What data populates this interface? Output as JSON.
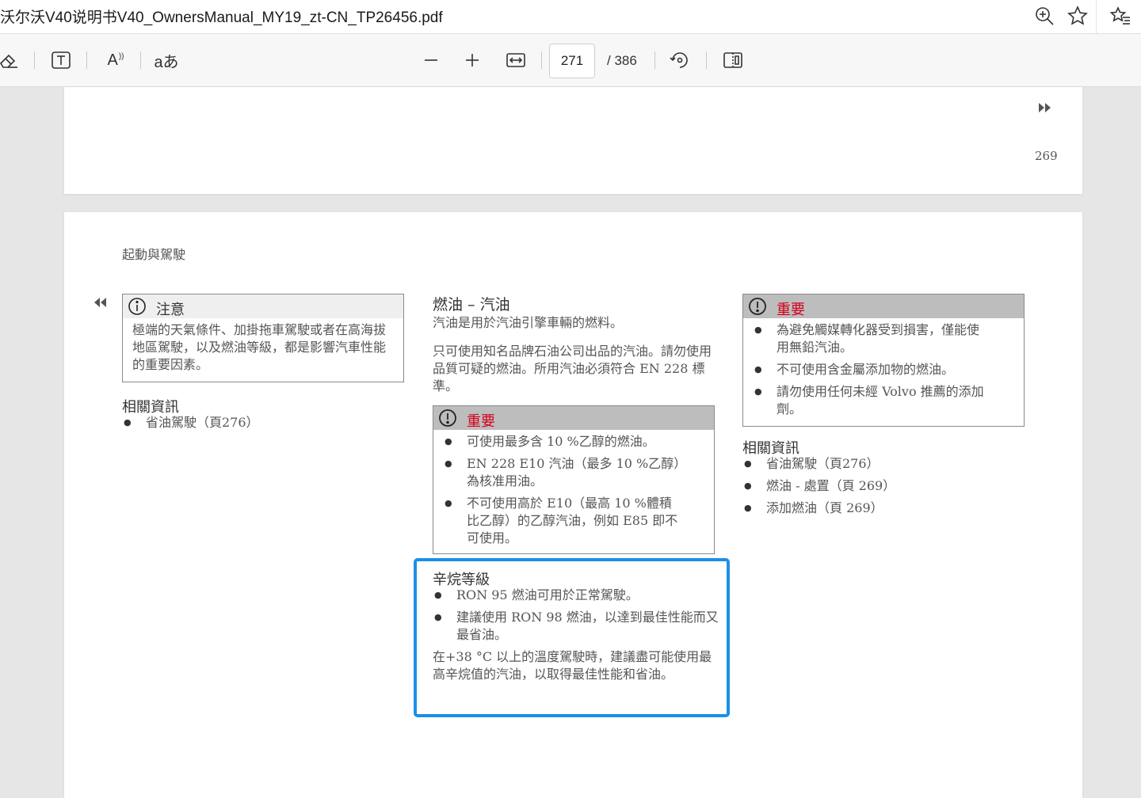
{
  "window": {
    "title": "沃尔沃V40说明书V40_OwnersManual_MY19_zt-CN_TP26456.pdf"
  },
  "titlebar": {
    "zoom_icon": "zoom-in-icon",
    "favorite_icon": "star-icon",
    "favorites_list_icon": "favorites-list-icon"
  },
  "toolbar": {
    "erase_icon": "eraser-icon",
    "text_icon": "text-box-icon",
    "read_aloud_label": "A",
    "translate_label": "aあ",
    "zoom_out_icon": "minus-icon",
    "zoom_in_icon": "plus-icon",
    "fit_icon": "fit-width-icon",
    "page_current": "271",
    "page_total": "/ 386",
    "rotate_icon": "rotate-icon",
    "layout_icon": "page-view-icon"
  },
  "page_top": {
    "page_number": "269",
    "next_icon": "double-chevron-right-icon"
  },
  "page_main": {
    "section_header": "起動與駕駛",
    "prev_icon": "double-chevron-left-icon",
    "col1": {
      "note_title": "注意",
      "note_body": "極端的天氣條件、加掛拖車駕駛或者在高海拔地區駕駛，以及燃油等級，都是影響汽車性能的重要因素。",
      "related_title": "相關資訊",
      "related_items": [
        "省油駕駛（頁276）"
      ]
    },
    "col2": {
      "title": "燃油 – 汽油",
      "subtitle": "汽油是用於汽油引擎車輛的燃料。",
      "paragraph": "只可使用知名品牌石油公司出品的汽油。請勿使用品質可疑的燃油。所用汽油必須符合 EN 228 標準。",
      "important_title": "重要",
      "important_items": [
        "可使用最多含 10 %乙醇的燃油。",
        "EN 228 E10 汽油（最多 10 %乙醇）為核准用油。",
        "不可使用高於 E10（最高 10 %體積比乙醇）的乙醇汽油，例如 E85 即不可使用。"
      ],
      "octane_title": "辛烷等級",
      "octane_items": [
        "RON 95 燃油可用於正常駕駛。",
        "建議使用 RON 98 燃油，以達到最佳性能而又最省油。"
      ],
      "octane_paragraph": "在+38 °C 以上的溫度駕駛時，建議盡可能使用最高辛烷值的汽油，以取得最佳性能和省油。"
    },
    "col3": {
      "important_title": "重要",
      "important_items": [
        "為避免觸媒轉化器受到損害，僅能使用無鉛汽油。",
        "不可使用含金屬添加物的燃油。",
        "請勿使用任何未經 Volvo 推薦的添加劑。"
      ],
      "related_title": "相關資訊",
      "related_items": [
        "省油駕駛（頁276）",
        "燃油 - 處置（頁 269）",
        "添加燃油（頁 269）"
      ]
    }
  }
}
